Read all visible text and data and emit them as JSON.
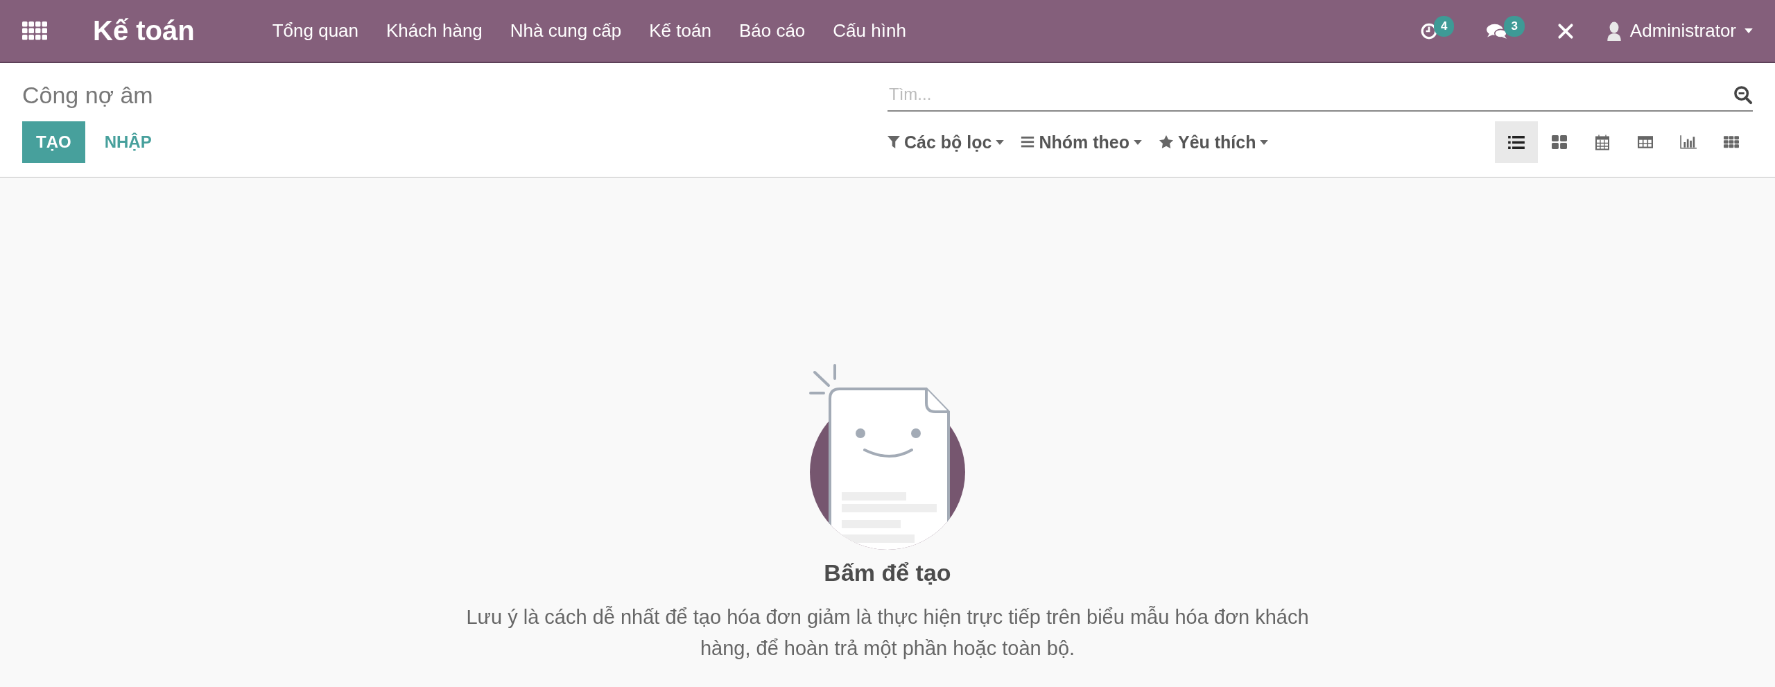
{
  "navbar": {
    "app_name": "Kế toán",
    "menu": [
      "Tổng quan",
      "Khách hàng",
      "Nhà cung cấp",
      "Kế toán",
      "Báo cáo",
      "Cấu hình"
    ],
    "activities_count": "4",
    "messages_count": "3",
    "user": "Administrator"
  },
  "control_panel": {
    "title": "Công nợ âm",
    "search": {
      "placeholder": "Tìm..."
    },
    "buttons": [
      {
        "label": "TẠO",
        "kind": "primary"
      },
      {
        "label": "NHẬP",
        "kind": "link"
      }
    ],
    "filters": [
      {
        "label": "Các bộ lọc",
        "kind": "filter"
      },
      {
        "label": "Nhóm theo",
        "kind": "group"
      },
      {
        "label": "Yêu thích",
        "kind": "favorite"
      }
    ],
    "views": [
      {
        "kind": "list",
        "selected": true
      },
      {
        "kind": "kanban",
        "selected": false
      },
      {
        "kind": "calendar",
        "selected": false
      },
      {
        "kind": "pivot",
        "selected": false
      },
      {
        "kind": "graph",
        "selected": false
      },
      {
        "kind": "grid",
        "selected": false
      }
    ]
  },
  "empty_state": {
    "title": "Bấm để tạo",
    "message": "Lưu ý là cách dễ nhất để tạo hóa đơn giảm là thực hiện trực tiếp trên biểu mẫu hóa đơn khách hàng, để hoàn trả một phần hoặc toàn bộ."
  }
}
